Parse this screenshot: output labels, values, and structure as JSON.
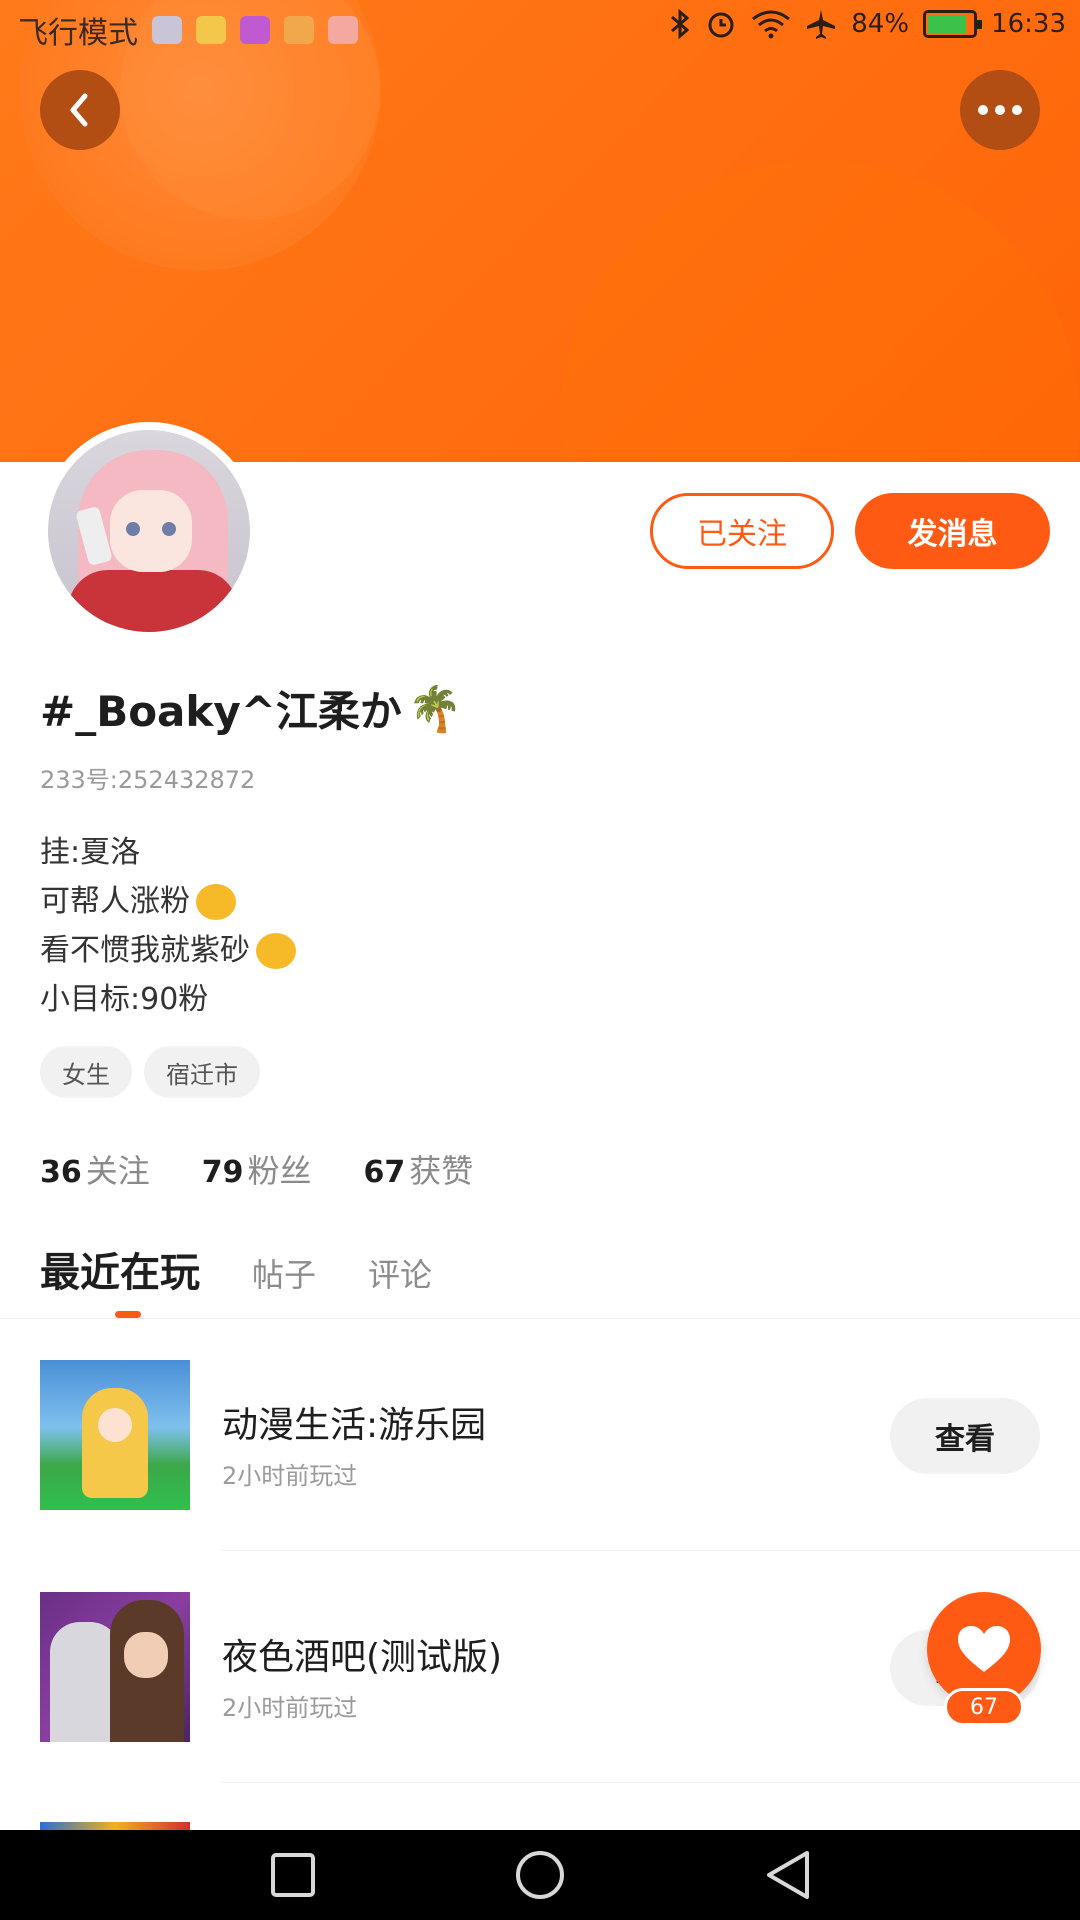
{
  "status_bar": {
    "left_text": "飞行模式",
    "battery": "84%",
    "time": "16:33",
    "icons": [
      "bluetooth-icon",
      "alarm-icon",
      "wifi-icon",
      "airplane-icon",
      "battery-icon"
    ]
  },
  "header": {
    "accent_color": "#ff6a10",
    "back_icon": "chevron-left-icon",
    "more_icon": "more-dots-icon"
  },
  "profile": {
    "follow_button": "已关注",
    "message_button": "发消息",
    "name": "#_Boaky^江柔か",
    "name_emoji": "🌴",
    "id_text": "233号:252432872",
    "bio": {
      "line1": "挂:夏洛",
      "line2": "可帮人涨粉",
      "line3": "看不惯我就紫砂",
      "line4": "小目标:90粉"
    },
    "tags": [
      "女生",
      "宿迁市"
    ]
  },
  "stats": {
    "following_num": "36",
    "following_label": "关注",
    "fans_num": "79",
    "fans_label": "粉丝",
    "likes_num": "67",
    "likes_label": "获赞"
  },
  "tabs": {
    "recent": "最近在玩",
    "posts": "帖子",
    "comments": "评论",
    "active": "recent"
  },
  "games": [
    {
      "title": "动漫生活:游乐园",
      "time": "2小时前玩过",
      "button": "查看"
    },
    {
      "title": "夜色酒吧(测试版)",
      "time": "2小时前玩过",
      "button": "查看"
    }
  ],
  "like_fab": {
    "count": "67",
    "icon": "heart-icon"
  },
  "nav": {
    "icons": [
      "recents-square-icon",
      "home-circle-icon",
      "back-triangle-icon"
    ]
  }
}
